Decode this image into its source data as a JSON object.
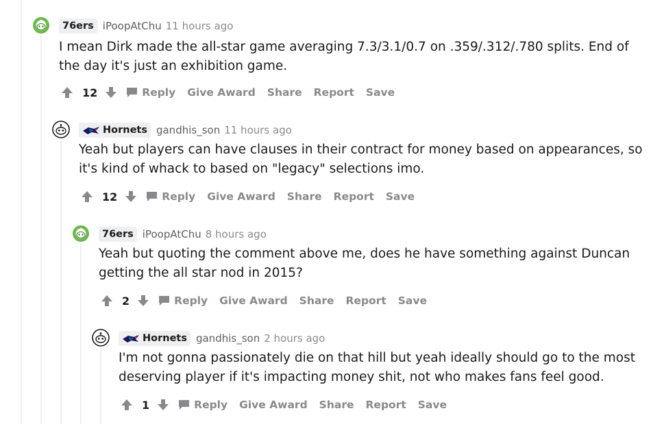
{
  "colors": {
    "action_gray": "#878a8c",
    "upvote_gray": "#878a8c",
    "flair_bg": "#edeff1",
    "sixers_avatar_green": "#6bb84b",
    "thread_line": "#edeff1"
  },
  "comments": [
    {
      "flair": "76ers",
      "flair_icon": "none",
      "avatar_icon": "green-snoo-avatar-icon",
      "author": "iPoopAtChu",
      "time": "11 hours ago",
      "body": "I mean Dirk made the all-star game averaging 7.3/3.1/0.7 on .359/.312/.780 splits. End of the day it's just an exhibition game.",
      "score": "12"
    },
    {
      "flair": "Hornets",
      "flair_icon": "hornets-logo-icon",
      "avatar_icon": "default-snoo-avatar-icon",
      "author": "gandhis_son",
      "time": "11 hours ago",
      "body": "Yeah but players can have clauses in their contract for money based on appearances, so it's kind of whack to based on \"legacy\" selections imo.",
      "score": "12"
    },
    {
      "flair": "76ers",
      "flair_icon": "none",
      "avatar_icon": "green-snoo-avatar-icon",
      "author": "iPoopAtChu",
      "time": "8 hours ago",
      "body": "Yeah but quoting the comment above me, does he have something against Duncan getting the all star nod in 2015?",
      "score": "2"
    },
    {
      "flair": "Hornets",
      "flair_icon": "hornets-logo-icon",
      "avatar_icon": "default-snoo-avatar-icon",
      "author": "gandhis_son",
      "time": "2 hours ago",
      "body": "I'm not gonna passionately die on that hill but yeah ideally should go to the most deserving player if it's impacting money shit, not who makes fans feel good.",
      "score": "1"
    }
  ],
  "actions": {
    "reply": "Reply",
    "give_award": "Give Award",
    "share": "Share",
    "report": "Report",
    "save": "Save"
  }
}
